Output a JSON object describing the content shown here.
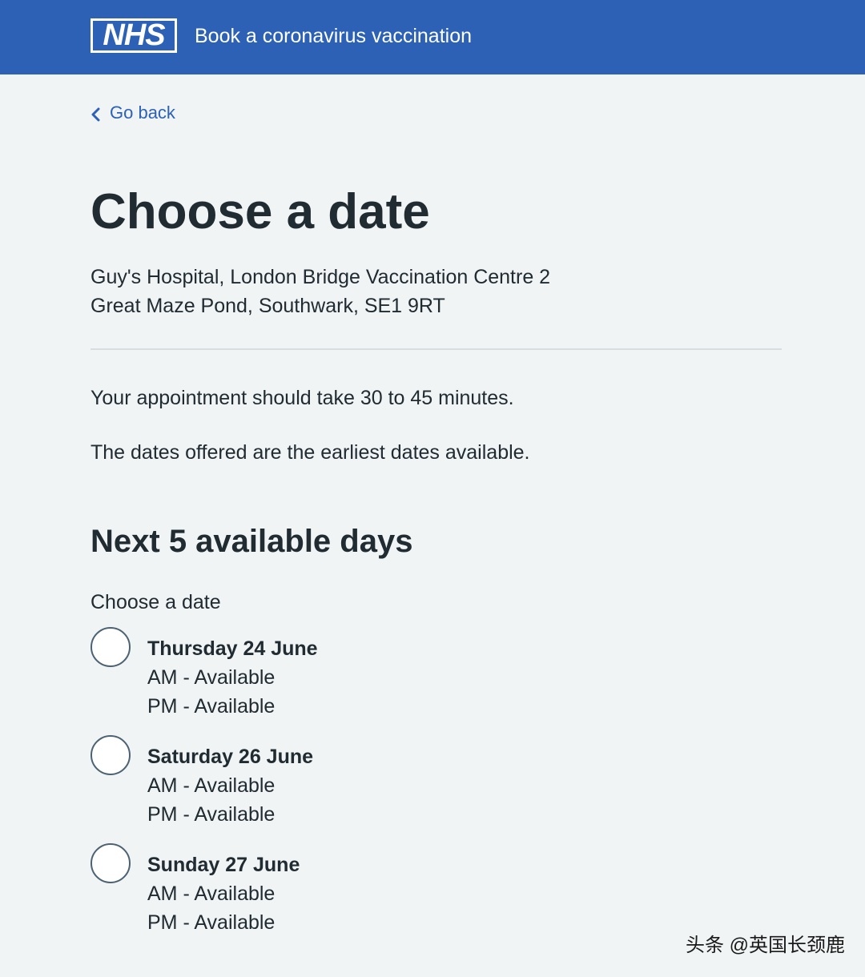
{
  "header": {
    "logo_text": "NHS",
    "service_name": "Book a coronavirus vaccination"
  },
  "back_link": "Go back",
  "title": "Choose a date",
  "address": {
    "line1": "Guy's Hospital, London Bridge Vaccination Centre 2",
    "line2": "Great Maze Pond, Southwark, SE1 9RT"
  },
  "info": {
    "duration": "Your appointment should take 30 to 45 minutes.",
    "earliest": "The dates offered are the earliest dates available."
  },
  "section_heading": "Next 5 available days",
  "legend": "Choose a date",
  "options": [
    {
      "date": "Thursday 24 June",
      "am": "AM - Available",
      "pm": "PM - Available",
      "selected": false
    },
    {
      "date": "Saturday 26 June",
      "am": "AM - Available",
      "pm": "PM - Available",
      "selected": false
    },
    {
      "date": "Sunday 27 June",
      "am": "AM - Available",
      "pm": "PM - Available",
      "selected": false
    }
  ],
  "watermark": "头条 @英国长颈鹿",
  "colors": {
    "brand_blue": "#2c61b6",
    "background": "#f0f4f5",
    "text": "#212b32"
  },
  "icons": {
    "back": "chevron-left-icon",
    "radio": "radio-circle"
  }
}
